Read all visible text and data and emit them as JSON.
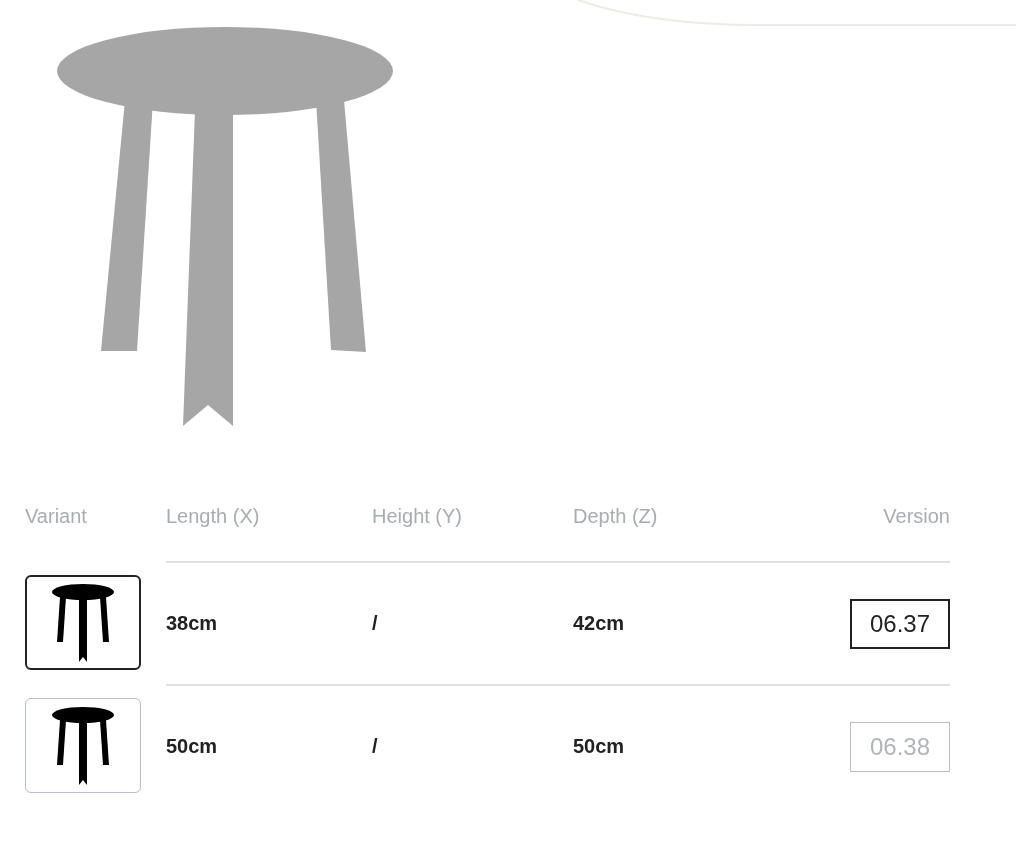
{
  "table": {
    "columns": [
      "Variant",
      "Length (X)",
      "Height (Y)",
      "Depth (Z)",
      "Version"
    ],
    "rows": [
      {
        "selected": true,
        "length": "38cm",
        "height": "/",
        "depth": "42cm",
        "version": "06.37"
      },
      {
        "selected": false,
        "length": "50cm",
        "height": "/",
        "depth": "50cm",
        "version": "06.38"
      }
    ]
  }
}
